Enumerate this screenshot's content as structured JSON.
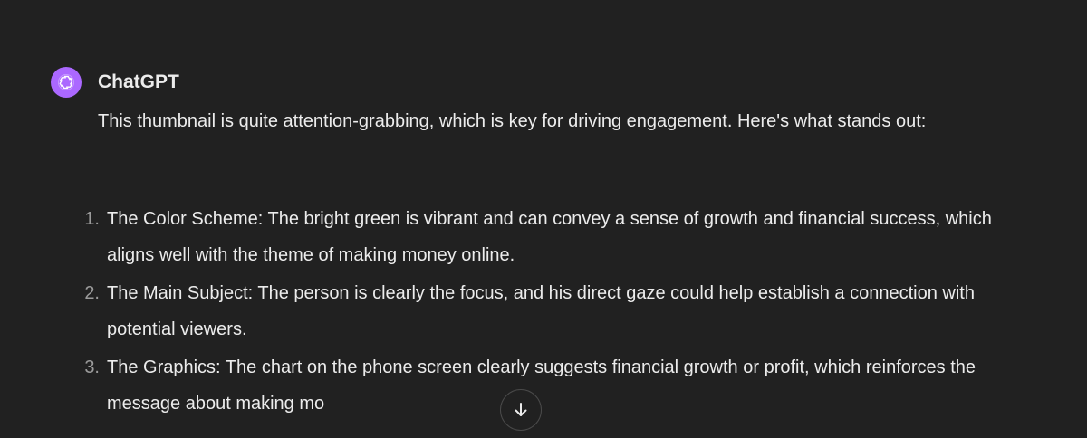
{
  "message": {
    "author": "ChatGPT",
    "avatar_icon": "openai-logo-icon",
    "avatar_color": "#ab68ff",
    "intro": "This thumbnail is quite attention-grabbing, which is key for driving engagement. Here's what stands out:",
    "list": [
      {
        "number": "1.",
        "text": "The Color Scheme: The bright green is vibrant and can convey a sense of growth and financial success, which aligns well with the theme of making money online."
      },
      {
        "number": "2.",
        "text": "The Main Subject: The person is clearly the focus, and his direct gaze could help establish a connection with potential viewers."
      },
      {
        "number": "3.",
        "text": "The Graphics: The chart on the phone screen clearly suggests financial growth or profit, which reinforces the message about making mo"
      }
    ]
  },
  "scroll_button": {
    "icon": "arrow-down-icon"
  },
  "colors": {
    "background": "#212121",
    "text": "#ececec",
    "list_number": "#9b9b9b"
  }
}
